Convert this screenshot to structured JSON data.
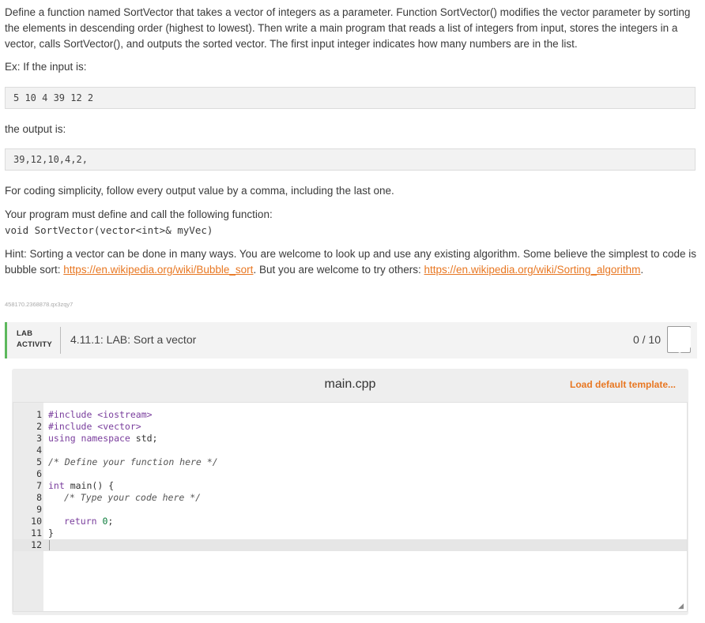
{
  "prompt": {
    "para1": "Define a function named SortVector that takes a vector of integers as a parameter. Function SortVector() modifies the vector parameter by sorting the elements in descending order (highest to lowest). Then write a main program that reads a list of integers from input, stores the integers in a vector, calls SortVector(), and outputs the sorted vector. The first input integer indicates how many numbers are in the list.",
    "example_intro": "Ex: If the input is:",
    "example_input": "5 10 4 39 12 2",
    "output_intro": "the output is:",
    "example_output": "39,12,10,4,2,",
    "simplicity_note": "For coding simplicity, follow every output value by a comma, including the last one.",
    "must_define": "Your program must define and call the following function:",
    "signature": "void SortVector(vector<int>& myVec)",
    "hint_part1": "Hint: Sorting a vector can be done in many ways. You are welcome to look up and use any existing algorithm. Some believe the simplest to code is bubble sort: ",
    "hint_link1": "https://en.wikipedia.org/wiki/Bubble_sort",
    "hint_part2": ". But you are welcome to try others: ",
    "hint_link2": "https://en.wikipedia.org/wiki/Sorting_algorithm",
    "hint_end": ".",
    "id_code": "458170.2368878.qx3zqy7"
  },
  "lab": {
    "tag_line1": "LAB",
    "tag_line2": "ACTIVITY",
    "title": "4.11.1: LAB: Sort a vector",
    "score": "0 / 10",
    "accent_color": "#5cb85c"
  },
  "editor": {
    "filename": "main.cpp",
    "load_template_label": "Load default template...",
    "line_numbers": [
      "1",
      "2",
      "3",
      "4",
      "5",
      "6",
      "7",
      "8",
      "9",
      "10",
      "11",
      "12"
    ],
    "line_1": "#include <iostream>",
    "line_2": "#include <vector>",
    "line_3_kw": "using namespace",
    "line_3_rest": " std;",
    "line_5": "/* Define your function here */",
    "line_7_kw": "int",
    "line_7_rest": " main() {",
    "line_8": "/* Type your code here */",
    "line_10_kw": "return",
    "line_10_num": "0",
    "line_10_end": ";",
    "line_11": "}"
  }
}
